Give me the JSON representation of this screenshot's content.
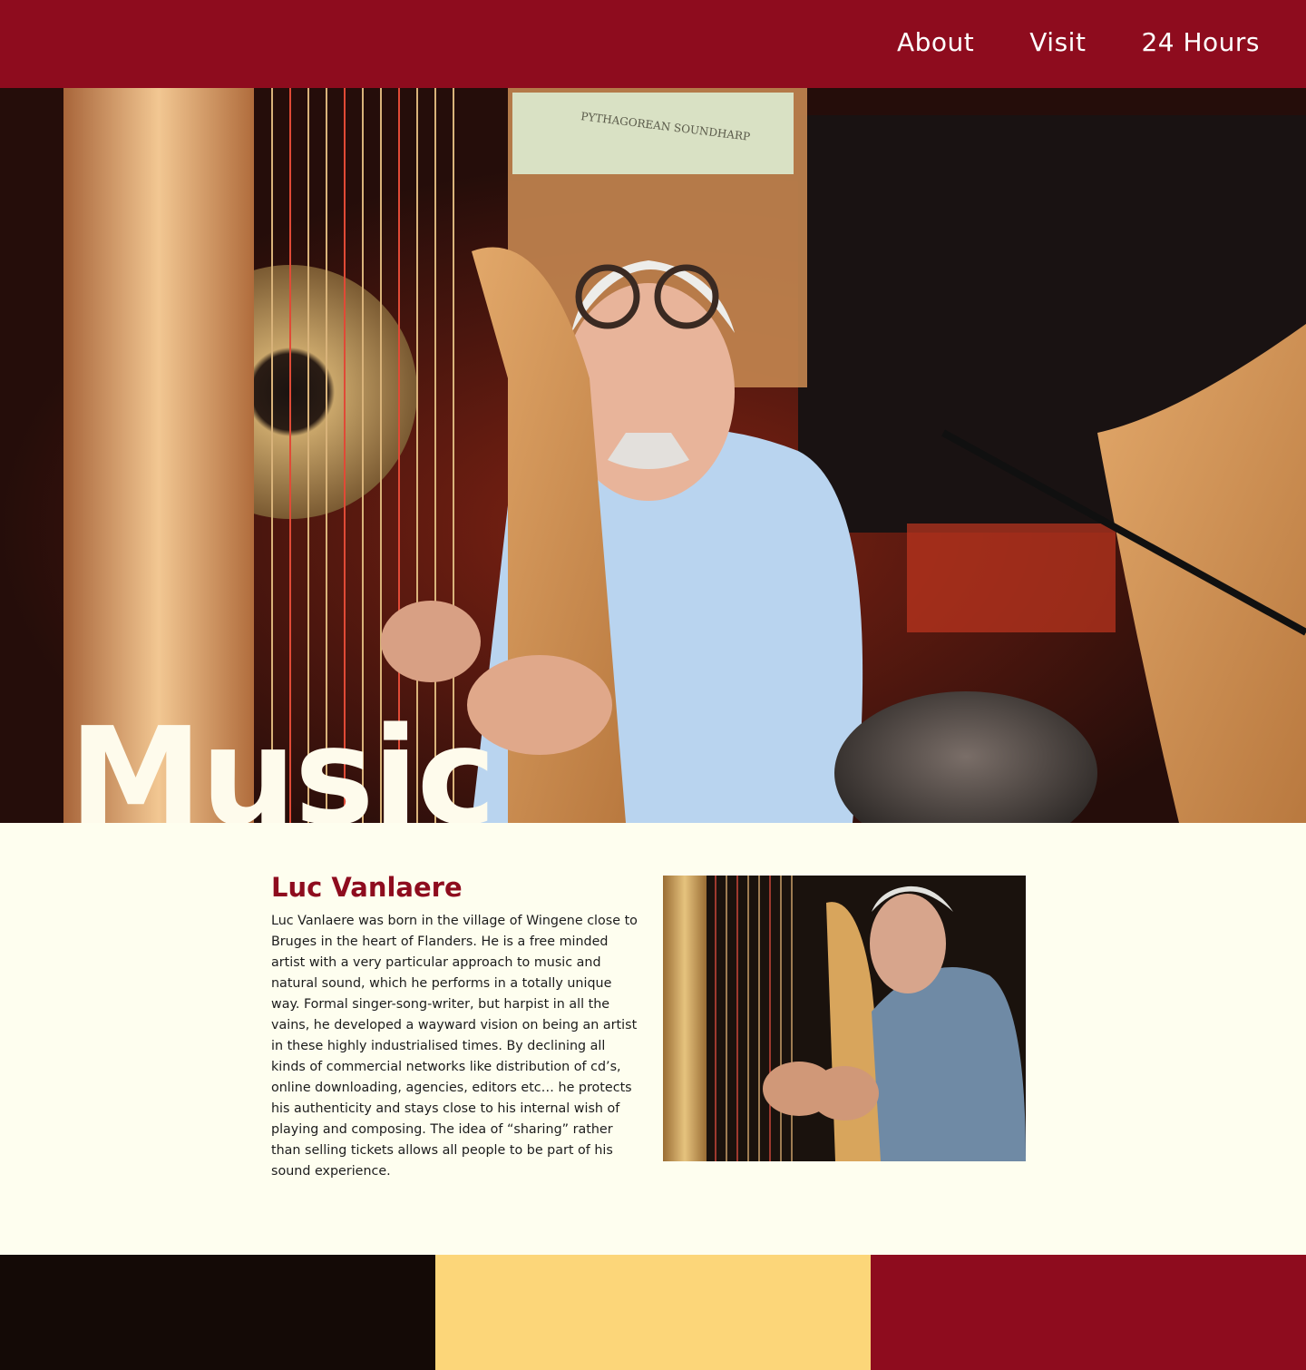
{
  "nav": {
    "items": [
      {
        "label": "About"
      },
      {
        "label": "Visit"
      },
      {
        "label": "24 Hours"
      }
    ]
  },
  "hero": {
    "title": "Music",
    "sign_text": "PYTHAGOREAN SOUNDHARP"
  },
  "bio": {
    "heading": "Luc Vanlaere",
    "text": "Luc Vanlaere was born in the village of Wingene close to Bruges in the heart of Flanders. He is a free minded artist with a very particular approach to music and natural sound, which he performs in a totally unique way. Formal singer-song-writer, but harpist in all the vains, he developed a wayward vision on being an artist in these highly industrialised times. By declining all kinds of commercial networks like distribution of cd’s, online downloading, agencies, editors etc… he protects his authenticity and stays close to his internal wish of playing and composing. The idea of “sharing” rather than selling tickets allows all people to be part of his sound experience."
  },
  "colors": {
    "brand": "#8e0c1e",
    "background": "#fefeef",
    "footer": [
      "#140a06",
      "#fcd679",
      "#8e0c1e"
    ]
  }
}
